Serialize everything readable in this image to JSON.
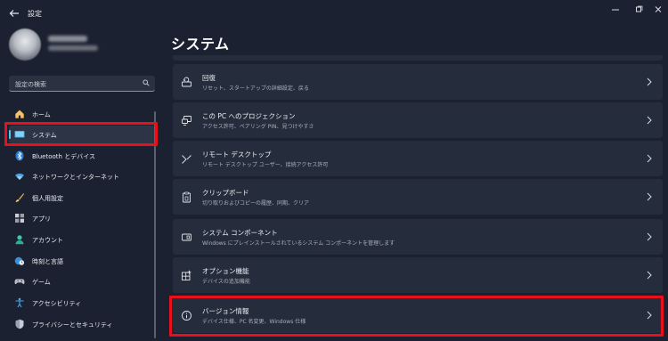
{
  "window": {
    "title": "設定"
  },
  "profile": {
    "name": "",
    "email": ""
  },
  "search": {
    "placeholder": "設定の検索"
  },
  "sidebar": {
    "items": [
      {
        "label": "ホーム",
        "icon": "home-icon"
      },
      {
        "label": "システム",
        "icon": "system-icon",
        "selected": true
      },
      {
        "label": "Bluetooth とデバイス",
        "icon": "bluetooth-icon"
      },
      {
        "label": "ネットワークとインターネット",
        "icon": "network-icon"
      },
      {
        "label": "個人用設定",
        "icon": "brush-icon"
      },
      {
        "label": "アプリ",
        "icon": "apps-icon"
      },
      {
        "label": "アカウント",
        "icon": "account-icon"
      },
      {
        "label": "時刻と言語",
        "icon": "globe-clock-icon"
      },
      {
        "label": "ゲーム",
        "icon": "gamepad-icon"
      },
      {
        "label": "アクセシビリティ",
        "icon": "accessibility-icon"
      },
      {
        "label": "プライバシーとセキュリティ",
        "icon": "shield-icon"
      }
    ]
  },
  "main": {
    "title": "システム",
    "cards": [
      {
        "title": "回復",
        "subtitle": "リセット、スタートアップの詳細設定、戻る",
        "icon": "recovery-icon"
      },
      {
        "title": "この PC へのプロジェクション",
        "subtitle": "アクセス許可、ペアリング PIN、見つけやすさ",
        "icon": "projection-icon"
      },
      {
        "title": "リモート デスクトップ",
        "subtitle": "リモート デスクトップ ユーザー、接続アクセス許可",
        "icon": "remote-desktop-icon"
      },
      {
        "title": "クリップボード",
        "subtitle": "切り取りおよびコピーの履歴、同期、クリア",
        "icon": "clipboard-icon"
      },
      {
        "title": "システム コンポーネント",
        "subtitle": "Windows にプレインストールされているシステム コンポーネントを管理します",
        "icon": "components-icon"
      },
      {
        "title": "オプション機能",
        "subtitle": "デバイスの追加機能",
        "icon": "optional-features-icon"
      },
      {
        "title": "バージョン情報",
        "subtitle": "デバイス仕様、PC 名変更、Windows 仕様",
        "icon": "info-icon"
      }
    ]
  },
  "colors": {
    "accent": "#4fc3f7",
    "highlight": "#e8101a",
    "background": "#1b2130",
    "card": "#252c3b"
  }
}
